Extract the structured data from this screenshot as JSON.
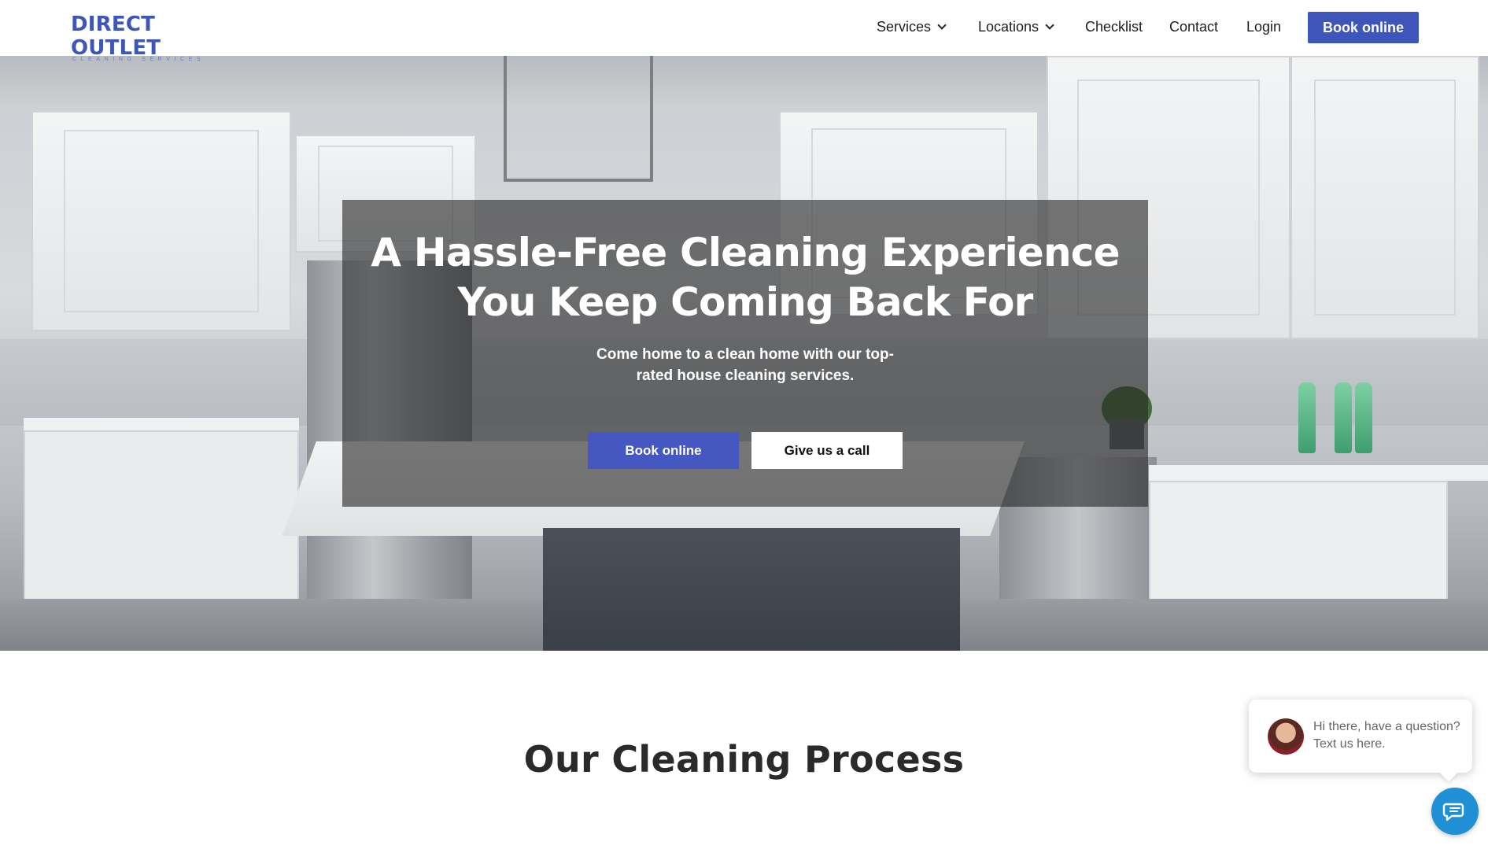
{
  "brand": {
    "name": "DIRECT OUTLET",
    "tagline": "CLEANING SERVICES",
    "accent_color": "#3e55b9"
  },
  "nav": {
    "items": [
      {
        "label": "Services",
        "has_dropdown": true
      },
      {
        "label": "Locations",
        "has_dropdown": true
      },
      {
        "label": "Checklist",
        "has_dropdown": false
      },
      {
        "label": "Contact",
        "has_dropdown": false
      },
      {
        "label": "Login",
        "has_dropdown": false
      }
    ],
    "cta_label": "Book online"
  },
  "hero": {
    "title_line1": "A Hassle-Free Cleaning Experience",
    "title_line2": "You Keep Coming Back For",
    "subtitle": "Come home to a clean home with our top-rated house cleaning services.",
    "primary_button": "Book online",
    "secondary_button": "Give us a call"
  },
  "section": {
    "title": "Our Cleaning Process"
  },
  "chat": {
    "message": "Hi there, have a question? Text us here.",
    "fab_color": "#1f8fd6",
    "icon": "chat-icon"
  }
}
